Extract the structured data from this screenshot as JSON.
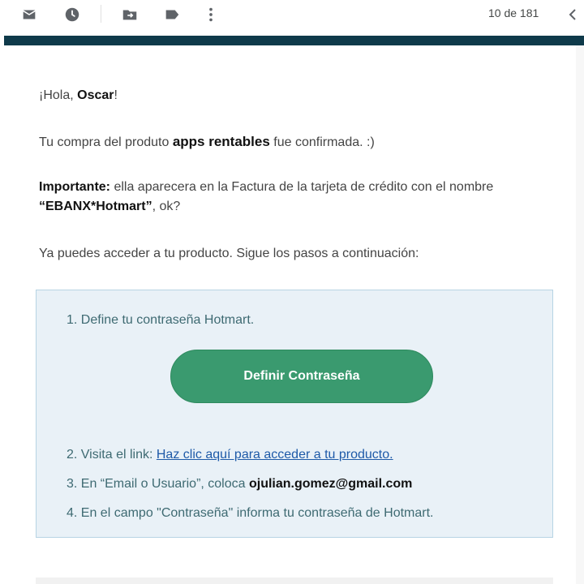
{
  "toolbar": {
    "icons": [
      "mark-unread-icon",
      "snooze-icon",
      "move-to-icon",
      "label-icon",
      "more-vert-icon",
      "chevron-left-icon"
    ],
    "counter": "10 de 181"
  },
  "email": {
    "greeting": {
      "prefix": "¡Hola, ",
      "name": "Oscar",
      "suffix": "!"
    },
    "purchase": {
      "prefix": "Tu compra del produto ",
      "product": "apps rentables",
      "suffix": " fue confirmada. :)"
    },
    "important": {
      "label": "Importante:",
      "text": " ella aparecera en la Factura de la tarjeta de crédito con el nombre ",
      "brand": "“EBANX*Hotmart”",
      "suffix": ", ok?"
    },
    "access_text": "Ya puedes acceder a tu producto. Sigue los pasos a continuación:",
    "steps": {
      "step1": "1. Define tu contraseña Hotmart.",
      "button_label": "Definir Contraseña",
      "step2_prefix": "2. Visita el link: ",
      "step2_link": "Haz clic aquí para acceder a tu producto.",
      "step3_prefix": "3. En “Email o Usuario”, coloca ",
      "step3_email": "ojulian.gomez@gmail.com",
      "step4": "4. En el campo \"Contraseña\" informa tu contraseña de Hotmart."
    }
  },
  "colors": {
    "header_bar": "#0f3a4a",
    "button_bg": "#3a9a6f",
    "steps_bg": "#e9f1f7",
    "steps_text": "#3e6a72",
    "link": "#1e5aa8"
  }
}
